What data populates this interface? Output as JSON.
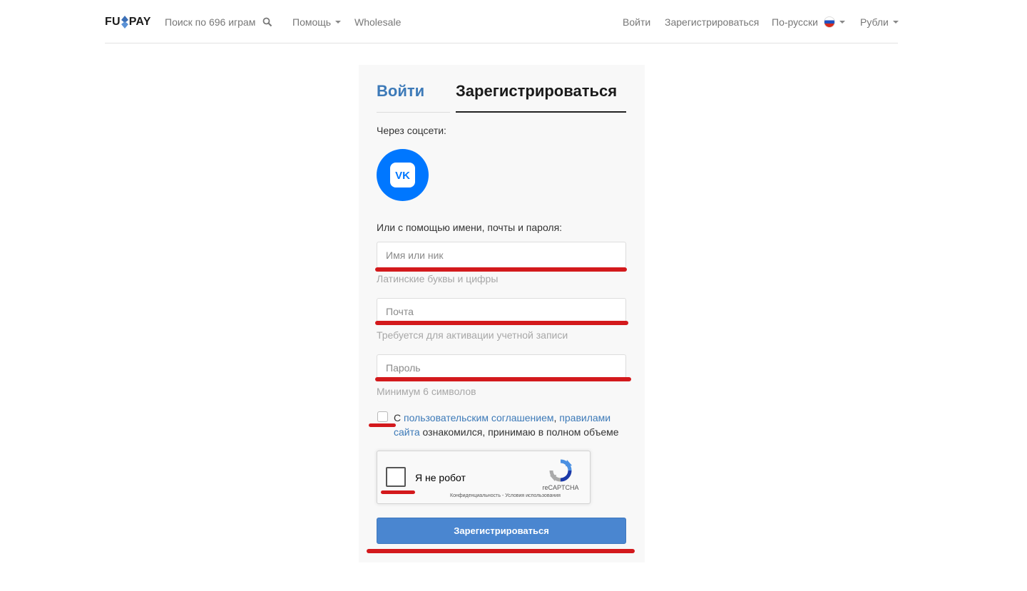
{
  "header": {
    "logo": {
      "left": "FU",
      "right": "PAY"
    },
    "search_label": "Поиск по 696 играм",
    "help_label": "Помощь",
    "wholesale_label": "Wholesale",
    "login_label": "Войти",
    "register_label": "Зарегистрироваться",
    "language_label": "По-русски",
    "currency_label": "Рубли"
  },
  "form": {
    "tabs": {
      "login": "Войти",
      "register": "Зарегистрироваться",
      "active": "register"
    },
    "social_label": "Через соцсети:",
    "social_icons": [
      "vk-icon"
    ],
    "alt_label": "Или с помощью имени, почты и пароля:",
    "username": {
      "placeholder": "Имя или ник",
      "value": "",
      "hint": "Латинские буквы и цифры"
    },
    "email": {
      "placeholder": "Почта",
      "value": "",
      "hint": "Требуется для активации учетной записи"
    },
    "password": {
      "placeholder": "Пароль",
      "value": "",
      "hint": "Минимум 6 символов"
    },
    "agreement": {
      "checked": false,
      "prefix": "С ",
      "link1": "пользовательским соглашением",
      "sep": ", ",
      "link2": "правилами сайта",
      "suffix": " ознакомился, принимаю в полном объеме"
    },
    "captcha": {
      "label": "Я не робот",
      "brand": "reCAPTCHA",
      "links": "Конфиденциальность - Условия использования"
    },
    "submit_label": "Зарегистрироваться"
  },
  "colors": {
    "accent": "#3d7ab8",
    "submit": "#4a86d0",
    "vk": "#0077ff",
    "annotation": "#d3191c"
  }
}
